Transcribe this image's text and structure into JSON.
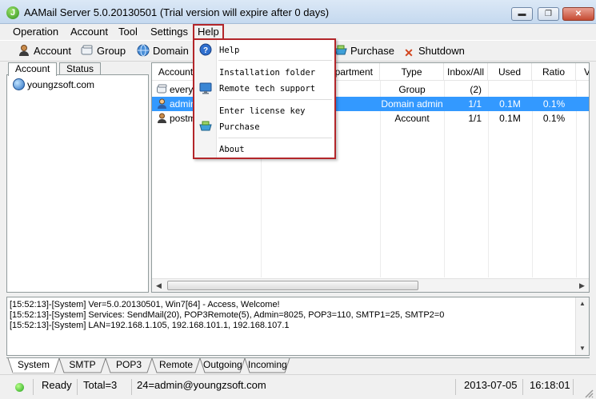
{
  "window": {
    "title": "AAMail Server 5.0.20130501 (Trial version will expire after 0 days)",
    "minimize": "▬",
    "maximize": "❐",
    "close": "✕"
  },
  "menubar": {
    "items": [
      "Operation",
      "Account",
      "Tool",
      "Settings",
      "Help"
    ]
  },
  "toolbar": {
    "account": "Account",
    "group": "Group",
    "domain": "Domain",
    "purchase": "Purchase",
    "shutdown": "Shutdown"
  },
  "left_tabs": [
    "Account",
    "Status"
  ],
  "tree": {
    "root": "youngzsoft.com"
  },
  "table": {
    "headers": [
      "Account",
      "",
      "Department",
      "Type",
      "Inbox/All",
      "Used",
      "Ratio",
      "V"
    ],
    "rows": [
      {
        "account": "everyo",
        "type": "Group",
        "inbox": "(2)",
        "used": "",
        "ratio": ""
      },
      {
        "account": "admin",
        "type": "Domain admin",
        "inbox": "1/1",
        "used": "0.1M",
        "ratio": "0.1%"
      },
      {
        "account": "postm",
        "type": "Account",
        "inbox": "1/1",
        "used": "0.1M",
        "ratio": "0.1%"
      }
    ]
  },
  "help_menu": {
    "help": "Help",
    "installation_folder": "Installation folder",
    "remote_support": "Remote tech support",
    "license_key": "Enter license key",
    "purchase": "Purchase",
    "about": "About"
  },
  "log": {
    "lines": [
      "[15:52:13]-[System] Ver=5.0.20130501, Win7[64] - Access, Welcome!",
      "[15:52:13]-[System] Services: SendMail(20), POP3Remote(5), Admin=8025, POP3=110, SMTP1=25, SMTP2=0",
      "[15:52:13]-[System] LAN=192.168.1.105, 192.168.101.1, 192.168.107.1"
    ]
  },
  "bottom_tabs": [
    "System",
    "SMTP",
    "POP3",
    "Remote",
    "Outgoing",
    "Incoming"
  ],
  "status": {
    "ready": "Ready",
    "total": "Total=3",
    "user": "24=admin@youngzsoft.com",
    "date": "2013-07-05",
    "time": "16:18:01"
  },
  "colors": {
    "selection": "#3399ff",
    "highlight_border": "#b3262a"
  }
}
